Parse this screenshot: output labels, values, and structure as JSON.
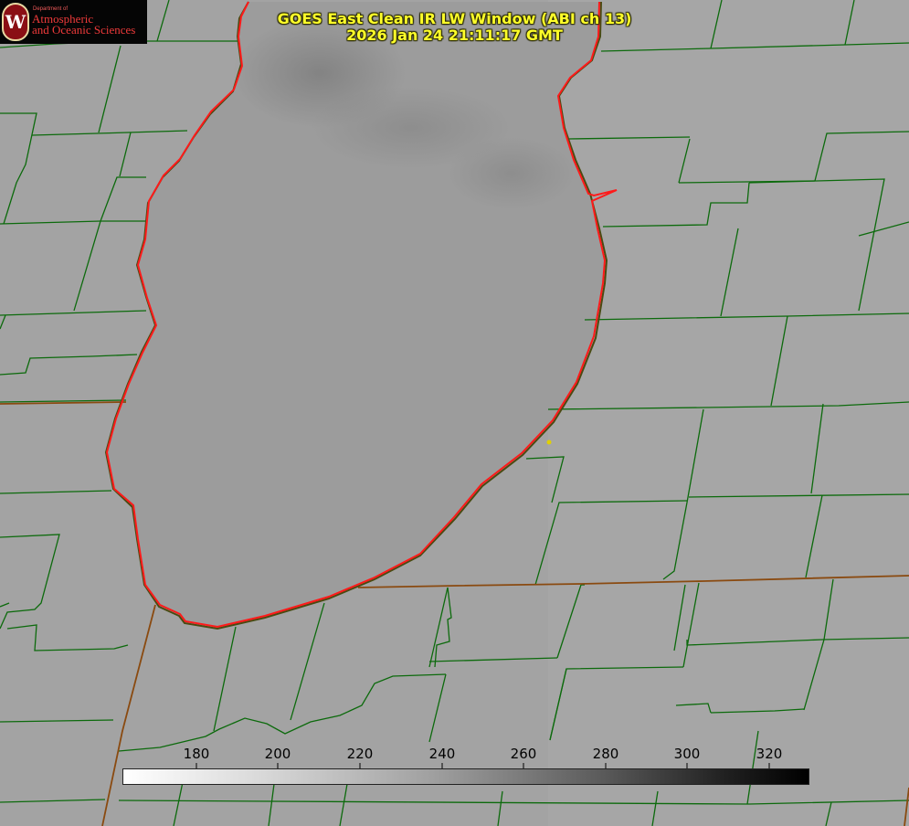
{
  "logo": {
    "department": "Department of",
    "line1": "Atmospheric",
    "line2": "and Oceanic Sciences",
    "seal_letter": "W"
  },
  "title": {
    "line1": "GOES East Clean IR LW Window (ABI ch 13)",
    "line2": "2026 Jan 24 21:11:17 GMT"
  },
  "colorbar": {
    "ticks": [
      "180",
      "200",
      "220",
      "240",
      "260",
      "280",
      "300",
      "320"
    ],
    "range": [
      172,
      332
    ],
    "gradient": "white-to-black"
  },
  "colors": {
    "background_gray": "#a2a2a2",
    "lake_gray": "#9e9e9e",
    "county_lines": "#0c6a0c",
    "state_lines": "#8a4a10",
    "shoreline": "#ff1a1a",
    "title_text": "#ffff2a",
    "marker": "#e0d000"
  }
}
